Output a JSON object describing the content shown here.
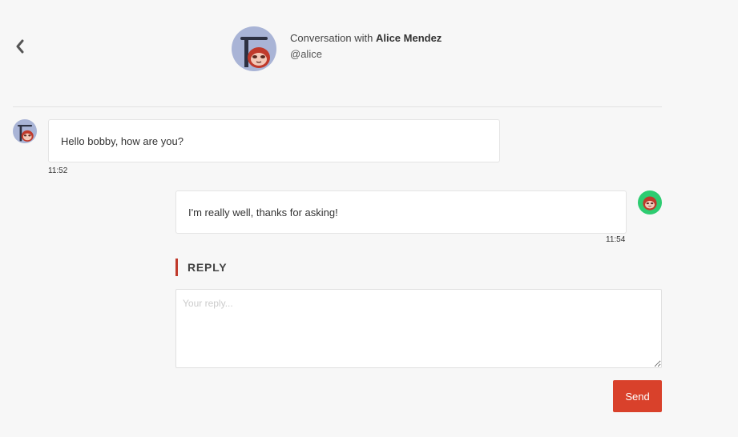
{
  "navigation": {
    "back_icon": "chevron-left-icon"
  },
  "header": {
    "title_prefix": "Conversation with",
    "contact_name": "Alice Mendez",
    "contact_handle": "@alice",
    "avatar_icon": "sloth-avatar-icon"
  },
  "messages": [
    {
      "sender": "alice",
      "text": "Hello bobby, how are you?",
      "time": "11:52",
      "avatar_icon": "sloth-avatar-icon"
    },
    {
      "sender": "bobby",
      "text": "I'm really well, thanks for asking!",
      "time": "11:54",
      "avatar_icon": "sloth-avatar-green-icon"
    }
  ],
  "reply": {
    "heading": "REPLY",
    "placeholder": "Your reply...",
    "value": "",
    "send_label": "Send"
  },
  "colors": {
    "accent": "#d9412b",
    "background": "#f7f7f7",
    "alice_avatar_bg": "#a9b4d6",
    "bobby_avatar_bg": "#2ecc71"
  }
}
